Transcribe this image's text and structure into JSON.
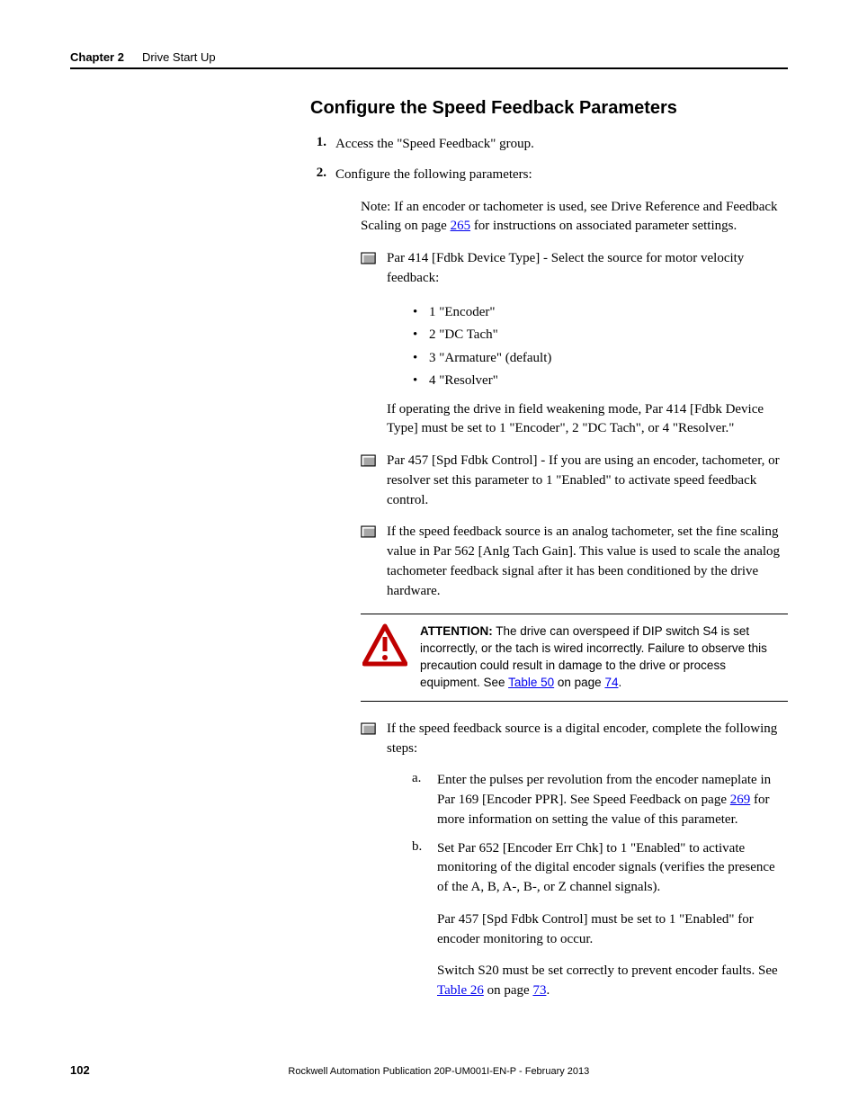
{
  "header": {
    "chapter_label": "Chapter 2",
    "chapter_title": "Drive Start Up"
  },
  "section_heading": "Configure the Speed Feedback Parameters",
  "step1": {
    "num": "1.",
    "text": "Access the \"Speed Feedback\" group."
  },
  "step2": {
    "num": "2.",
    "text": "Configure the following parameters:"
  },
  "note": {
    "prefix": "Note: If an encoder or tachometer is used, see Drive Reference and Feedback Scaling on page ",
    "link": "265",
    "suffix": " for instructions on associated parameter settings."
  },
  "check1": "Par 414 [Fdbk Device Type] - Select the source for motor velocity feedback:",
  "bullets": {
    "b1": "1 \"Encoder\"",
    "b2": "2 \"DC Tach\"",
    "b3": "3 \"Armature\" (default)",
    "b4": "4 \"Resolver\""
  },
  "check1_sub": "If operating the drive in field weakening mode, Par 414 [Fdbk Device Type] must be set to 1 \"Encoder\", 2 \"DC Tach\", or 4 \"Resolver.\"",
  "check2": "Par 457 [Spd Fdbk Control] - If you are using an encoder, tachometer, or resolver set this parameter to 1 \"Enabled\" to activate speed feedback control.",
  "check3": "If the speed feedback source is an analog tachometer, set the fine scaling value in Par 562 [Anlg Tach Gain]. This value is used to scale the analog tachometer feedback signal after it has been conditioned by the drive hardware.",
  "attention": {
    "label": "ATTENTION:",
    "body": " The drive can overspeed if DIP switch S4 is set incorrectly, or the tach is wired incorrectly. Failure to observe this precaution could result in damage to the drive or process equipment. See ",
    "link1": "Table 50",
    "mid": " on page ",
    "link2": "74",
    "end": "."
  },
  "check4": "If the speed feedback source is a digital encoder, complete the following steps:",
  "sub_a": {
    "letter": "a.",
    "prefix": "Enter the pulses per revolution from the encoder nameplate in Par 169 [Encoder PPR]. See Speed Feedback on page ",
    "link": "269",
    "suffix": " for more information on setting the value of this parameter."
  },
  "sub_b": {
    "letter": "b.",
    "text": "Set Par 652 [Encoder Err Chk] to 1 \"Enabled\" to activate monitoring of the digital encoder signals (verifies the presence of the A, B, A-, B-, or Z channel signals)."
  },
  "sub_b_p1": "Par 457 [Spd Fdbk Control] must be set to 1 \"Enabled\" for encoder monitoring to occur.",
  "sub_b_p2": {
    "prefix": "Switch S20 must be set correctly to prevent encoder faults. See ",
    "link1": "Table 26",
    "mid": " on page ",
    "link2": "73",
    "end": "."
  },
  "footer": {
    "page": "102",
    "text": "Rockwell Automation Publication 20P-UM001I-EN-P - February 2013"
  }
}
